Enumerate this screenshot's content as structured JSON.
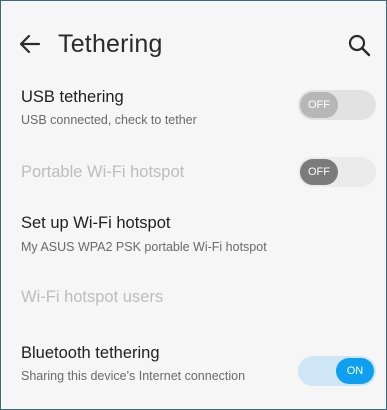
{
  "header": {
    "title": "Tethering",
    "back_icon": "arrow-left-icon",
    "search_icon": "search-icon"
  },
  "items": [
    {
      "title": "USB tethering",
      "subtitle": "USB connected, check to tether",
      "toggle": {
        "state": "off",
        "label": "OFF"
      }
    },
    {
      "title": "Portable Wi-Fi hotspot",
      "toggle": {
        "state": "off",
        "label": "OFF"
      }
    },
    {
      "title": "Set up Wi-Fi hotspot",
      "subtitle": "My ASUS WPA2 PSK portable Wi-Fi hotspot"
    },
    {
      "title": "Wi-Fi hotspot users"
    },
    {
      "title": "Bluetooth tethering",
      "subtitle": "Sharing this device's Internet connection",
      "toggle": {
        "state": "on",
        "label": "ON"
      }
    }
  ],
  "colors": {
    "accent": "#0f9ff0",
    "background": "#f6f6f6",
    "disabled_text": "#bdbdbd"
  }
}
